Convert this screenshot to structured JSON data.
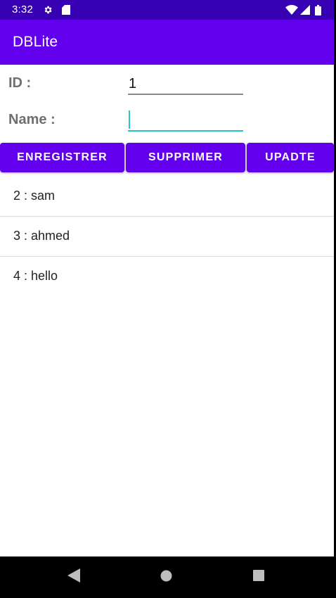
{
  "status_bar": {
    "time": "3:32",
    "icons": [
      "gear-icon",
      "sd-card-icon",
      "wifi-icon",
      "signal-icon",
      "battery-icon"
    ]
  },
  "app_bar": {
    "title": "DBLite"
  },
  "form": {
    "id_label": "ID :",
    "id_value": "1",
    "name_label": "Name :",
    "name_value": ""
  },
  "buttons": {
    "save": "ENREGISTRER",
    "delete": "SUPPRIMER",
    "update": "UPADTE"
  },
  "list": {
    "items": [
      {
        "label": "2 : sam"
      },
      {
        "label": "3 : ahmed"
      },
      {
        "label": "4 : hello"
      }
    ]
  },
  "nav_bar": {
    "icons": [
      "back-icon",
      "home-icon",
      "recents-icon"
    ]
  },
  "colors": {
    "status_bar": "#3700b3",
    "primary": "#6200ee",
    "accent": "#26c6c6",
    "label_gray": "#6f6f6f"
  }
}
